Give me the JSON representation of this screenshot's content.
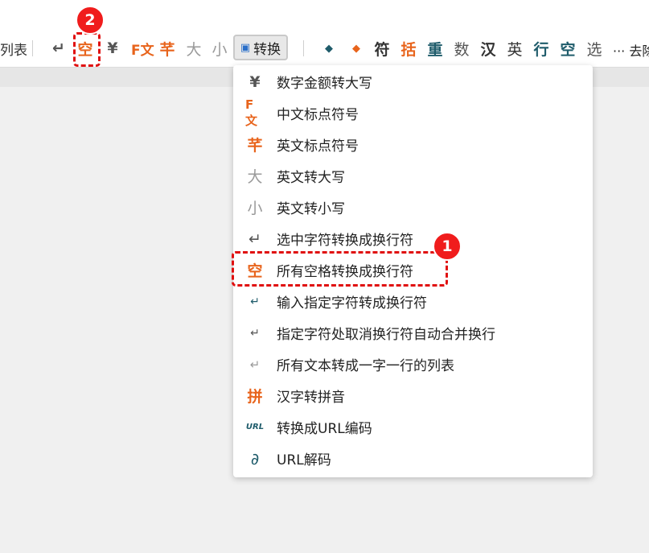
{
  "toolbar": {
    "left_text": "列表",
    "items": [
      {
        "name": "return-icon",
        "glyph": "↵"
      },
      {
        "name": "space-char-icon",
        "glyph": "空"
      },
      {
        "name": "yen-icon",
        "glyph": "¥"
      },
      {
        "name": "cn-punct-icon",
        "glyph": "F文"
      },
      {
        "name": "en-punct-icon",
        "glyph": "芊"
      },
      {
        "name": "upper-icon",
        "glyph": "大"
      },
      {
        "name": "lower-icon",
        "glyph": "小"
      }
    ],
    "convert_label": "转换",
    "right_items": [
      {
        "name": "align-left-icon",
        "glyph": "◆"
      },
      {
        "name": "align-right-icon",
        "glyph": "◆"
      },
      {
        "name": "symbol-icon",
        "glyph": "符"
      },
      {
        "name": "bracket-icon",
        "glyph": "括"
      },
      {
        "name": "duplicate-icon",
        "glyph": "重"
      },
      {
        "name": "number-icon",
        "glyph": "数"
      },
      {
        "name": "chinese-icon",
        "glyph": "汉"
      },
      {
        "name": "english-icon",
        "glyph": "英"
      },
      {
        "name": "line-icon",
        "glyph": "行"
      },
      {
        "name": "space-icon",
        "glyph": "空"
      },
      {
        "name": "select-icon",
        "glyph": "选"
      }
    ],
    "more_label": "··· 去除"
  },
  "markers": {
    "first": "1",
    "second": "2"
  },
  "menu": {
    "items": [
      {
        "label": "数字金额转大写",
        "icon": "yen-icon",
        "glyph": "¥"
      },
      {
        "label": "中文标点符号",
        "icon": "cn-punct-icon",
        "glyph": "F文"
      },
      {
        "label": "英文标点符号",
        "icon": "en-punct-icon",
        "glyph": "芊"
      },
      {
        "label": "英文转大写",
        "icon": "upper-icon",
        "glyph": "大"
      },
      {
        "label": "英文转小写",
        "icon": "lower-icon",
        "glyph": "小"
      },
      {
        "label": "选中字符转换成换行符",
        "icon": "return-icon",
        "glyph": "↵"
      },
      {
        "label": "所有空格转换成换行符",
        "icon": "space-char-icon",
        "glyph": "空"
      },
      {
        "label": "输入指定字符转成换行符",
        "icon": "small-return-icon",
        "glyph": "↵"
      },
      {
        "label": "指定字符处取消换行符自动合并换行",
        "icon": "merge-return-icon",
        "glyph": "↵"
      },
      {
        "label": "所有文本转成一字一行的列表",
        "icon": "list-return-icon",
        "glyph": "↵"
      },
      {
        "label": "汉字转拼音",
        "icon": "pinyin-icon",
        "glyph": "拼"
      },
      {
        "label": "转换成URL编码",
        "icon": "url-encode-icon",
        "glyph": "URL"
      },
      {
        "label": "URL解码",
        "icon": "link-icon",
        "glyph": "∂"
      }
    ]
  }
}
